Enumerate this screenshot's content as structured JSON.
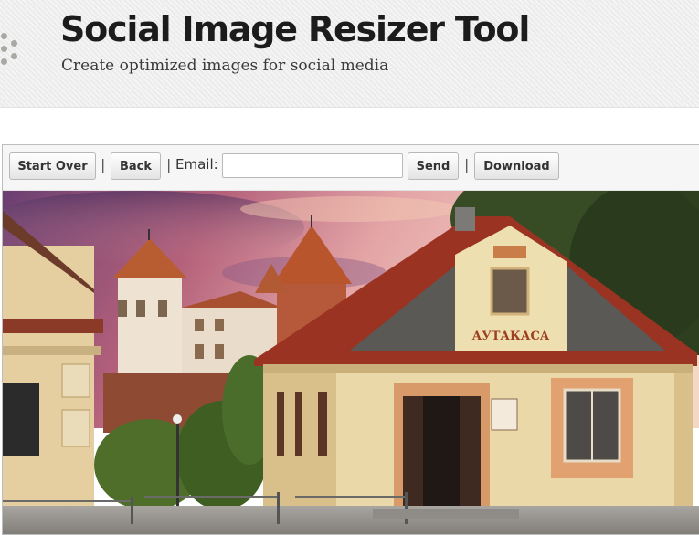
{
  "header": {
    "title": "Social Image Resizer Tool",
    "subtitle": "Create optimized images for social media"
  },
  "toolbar": {
    "start_over_label": "Start Over",
    "back_label": "Back",
    "separator": "|",
    "email_label": "Email:",
    "email_value": "",
    "send_label": "Send",
    "download_label": "Download"
  },
  "photo": {
    "sign_text": "АУТАКАСА"
  },
  "colors": {
    "header_bg": "#efefef",
    "title": "#1c1c1c",
    "roof_red": "#9b3322",
    "wall_cream": "#ecdcae"
  }
}
